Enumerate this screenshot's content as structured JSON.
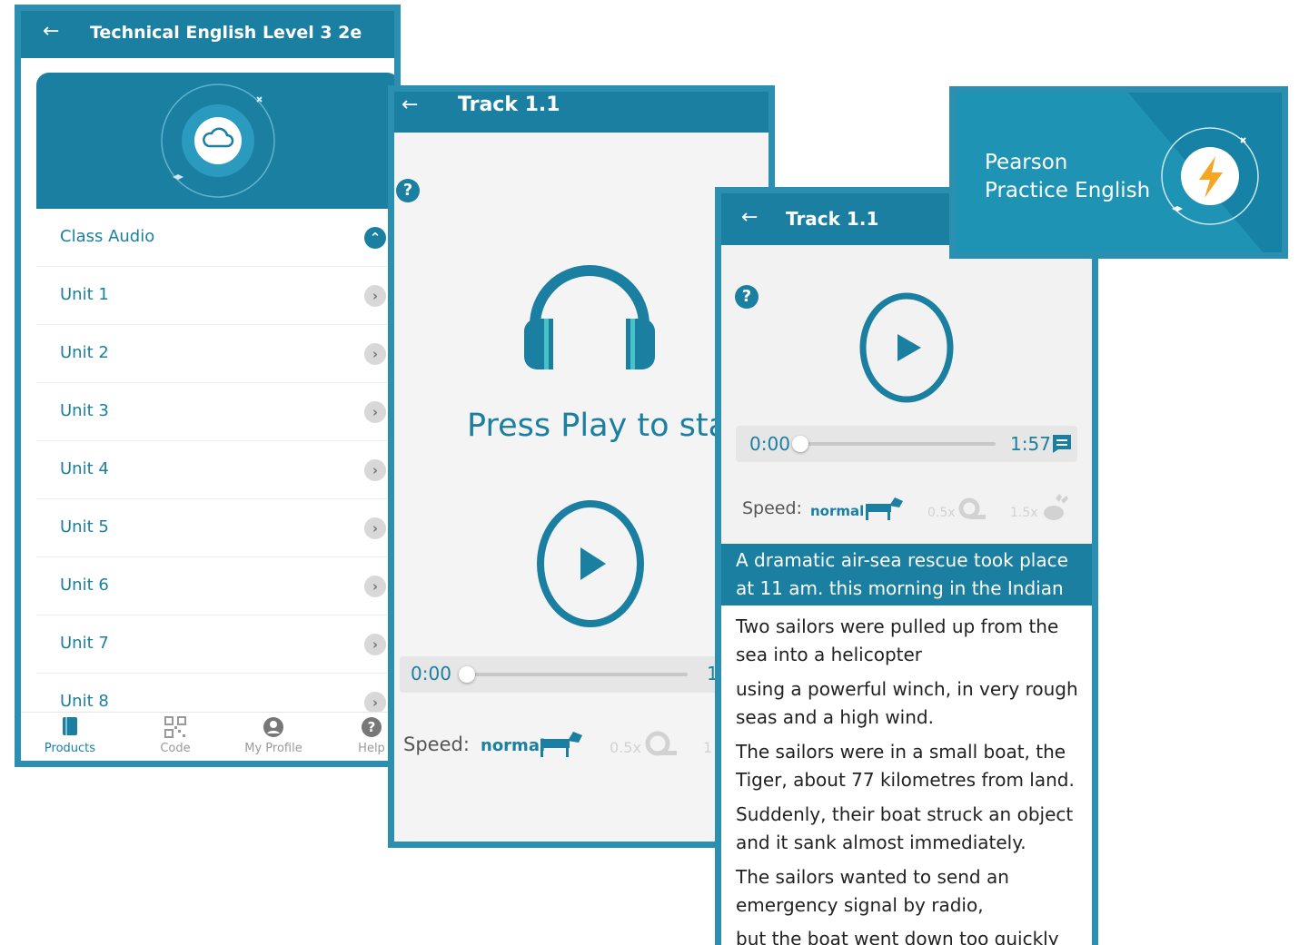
{
  "screen1": {
    "back_icon": "arrow-left-icon",
    "title": "Technical English Level 3 2e",
    "hero_icon": "cloud-icon",
    "section": "Class Audio",
    "units": [
      "Unit 1",
      "Unit 2",
      "Unit 3",
      "Unit 4",
      "Unit 5",
      "Unit 6",
      "Unit 7",
      "Unit 8"
    ],
    "nav": [
      {
        "label": "Products",
        "icon": "book-icon",
        "active": true
      },
      {
        "label": "Code",
        "icon": "qr-code-icon",
        "active": false
      },
      {
        "label": "My Profile",
        "icon": "profile-icon",
        "active": false
      },
      {
        "label": "Help",
        "icon": "help-icon",
        "active": false
      }
    ]
  },
  "screen2": {
    "title": "Track 1.1",
    "prompt": "Press Play to start",
    "time_current": "0:00",
    "time_total_partial": "1",
    "speed_label": "Speed:",
    "speed_normal": "normal",
    "speed_slow": "0.5x",
    "speed_fast_partial": "1"
  },
  "screen3": {
    "title": "Track 1.1",
    "time_current": "0:00",
    "time_total": "1:57",
    "speed_label": "Speed:",
    "speed_normal": "normal",
    "speed_slow": "0.5x",
    "speed_fast": "1.5x",
    "transcript": [
      "A dramatic air-sea rescue took place at 11 am. this morning in the Indian Ocean.",
      "Two sailors were pulled up from the sea into a helicopter",
      "using a powerful winch, in very rough seas and a high wind.",
      "The sailors were in a small boat, the Tiger, about 77 kilometres from land.",
      "Suddenly, their boat struck an object and it sank almost immediately.",
      "The sailors wanted to send an emergency signal by radio,",
      "but the boat went down too quickly and"
    ]
  },
  "banner": {
    "line1": "Pearson",
    "line2": "Practice English",
    "logo_icon": "lightning-bolt-icon"
  },
  "colors": {
    "primary": "#1a7fa0",
    "border": "#2a8fb1",
    "accent": "#f5a623"
  }
}
